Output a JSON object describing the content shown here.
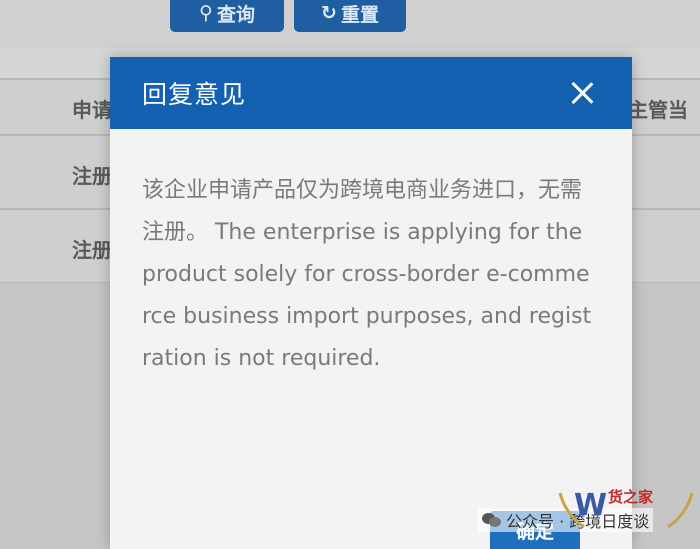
{
  "background": {
    "toolbar": {
      "query_label": "查询",
      "reset_label": "重置"
    },
    "table": {
      "header_left": "申请",
      "header_right": "主管当",
      "rows": [
        {
          "cell": "注册"
        },
        {
          "cell": "注册"
        }
      ]
    }
  },
  "modal": {
    "title": "回复意见",
    "body": "该企业申请产品仅为跨境电商业务进口，无需注册。 The enterprise is applying for the product solely for cross-border e-commerce business import purposes, and registration is not required.",
    "confirm_label": "确定"
  },
  "watermark": {
    "text": "公众号 · 跨境日度谈",
    "logo_text": "货之家"
  },
  "colors": {
    "header": "#1361b0",
    "button": "#1f5ea0",
    "logo": "#c42a2a"
  }
}
